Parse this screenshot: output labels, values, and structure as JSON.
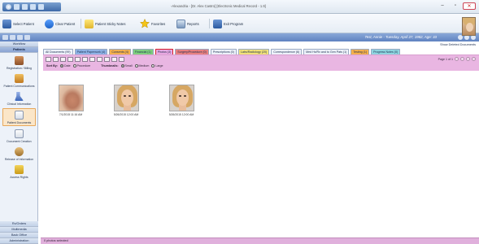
{
  "window": {
    "title": "-Alexandria - [Dr. Alex Castro] [Electronic Medical Record - 1.9]",
    "buttons": {
      "minimize": "–",
      "maximize": "▫",
      "close": "✕"
    }
  },
  "toolbar": {
    "select_patient": "Select Patient",
    "clear_patient": "Clear Patient",
    "sticky_notes": "Patient Sticky Notes",
    "favorites": "Favorites",
    "reports": "Reports",
    "exit": "Exit Program"
  },
  "header": {
    "patient_info": "Test, Annie - Tuesday, April 27, 1982, Age: 33"
  },
  "sidebar": {
    "tabs_top": [
      "Workflow",
      "Patients"
    ],
    "items": [
      {
        "label": "Registration / Billing",
        "icon": "registration-icon"
      },
      {
        "label": "Patient Communications",
        "icon": "communications-icon"
      },
      {
        "label": "Clinical Information",
        "icon": "clinical-icon"
      },
      {
        "label": "Patient Documents",
        "icon": "documents-icon"
      },
      {
        "label": "Document Creation",
        "icon": "document-creation-icon"
      },
      {
        "label": "Release of Information",
        "icon": "release-icon"
      },
      {
        "label": "Access Rights",
        "icon": "access-rights-icon"
      }
    ],
    "tabs_bottom": [
      "Rx/Orders",
      "Multimedia",
      "Back Office",
      "Administration"
    ]
  },
  "main": {
    "show_deleted": "Show Deleted Documents",
    "tabs": [
      {
        "label": "All Documents (99)",
        "color": "#eef2fa"
      },
      {
        "label": "Patient Paperwork (4)",
        "color": "#8fb3e6"
      },
      {
        "label": "Consents (4)",
        "color": "#f5b04d"
      },
      {
        "label": "Financial (1)",
        "color": "#7fd07f"
      },
      {
        "label": "Photos (3)",
        "color": "#e9a8e2"
      },
      {
        "label": "Surgery/Procedure (0)",
        "color": "#e88080"
      },
      {
        "label": "Prescriptions (0)",
        "color": "#eef2fa"
      },
      {
        "label": "Labs/Radiology (20)",
        "color": "#f2e27a"
      },
      {
        "label": "Correspondence (6)",
        "color": "#eef2fa"
      },
      {
        "label": "Med Hx/Rx and to Gen Pats (1)",
        "color": "#eef2fa"
      },
      {
        "label": "Testing (1)",
        "color": "#f5b04d"
      },
      {
        "label": "Progress Notes (0)",
        "color": "#8fd6e0"
      }
    ],
    "selected_tab": "Photos (3)",
    "pager": "Page 1 of 1",
    "sort_label": "Sort By:",
    "sort_options": [
      "Date",
      "Procedure"
    ],
    "thumbnails_label": "Thumbnails:",
    "size_options": [
      "Small",
      "Medium",
      "Large"
    ],
    "photos": [
      {
        "caption": "7/1/2015 11:16 AM",
        "kind": "wound"
      },
      {
        "caption": "5/26/2015 12:00 AM",
        "kind": "face"
      },
      {
        "caption": "5/26/2015 12:00 AM",
        "kind": "face"
      }
    ]
  },
  "status": {
    "text": "0 photos selected"
  }
}
